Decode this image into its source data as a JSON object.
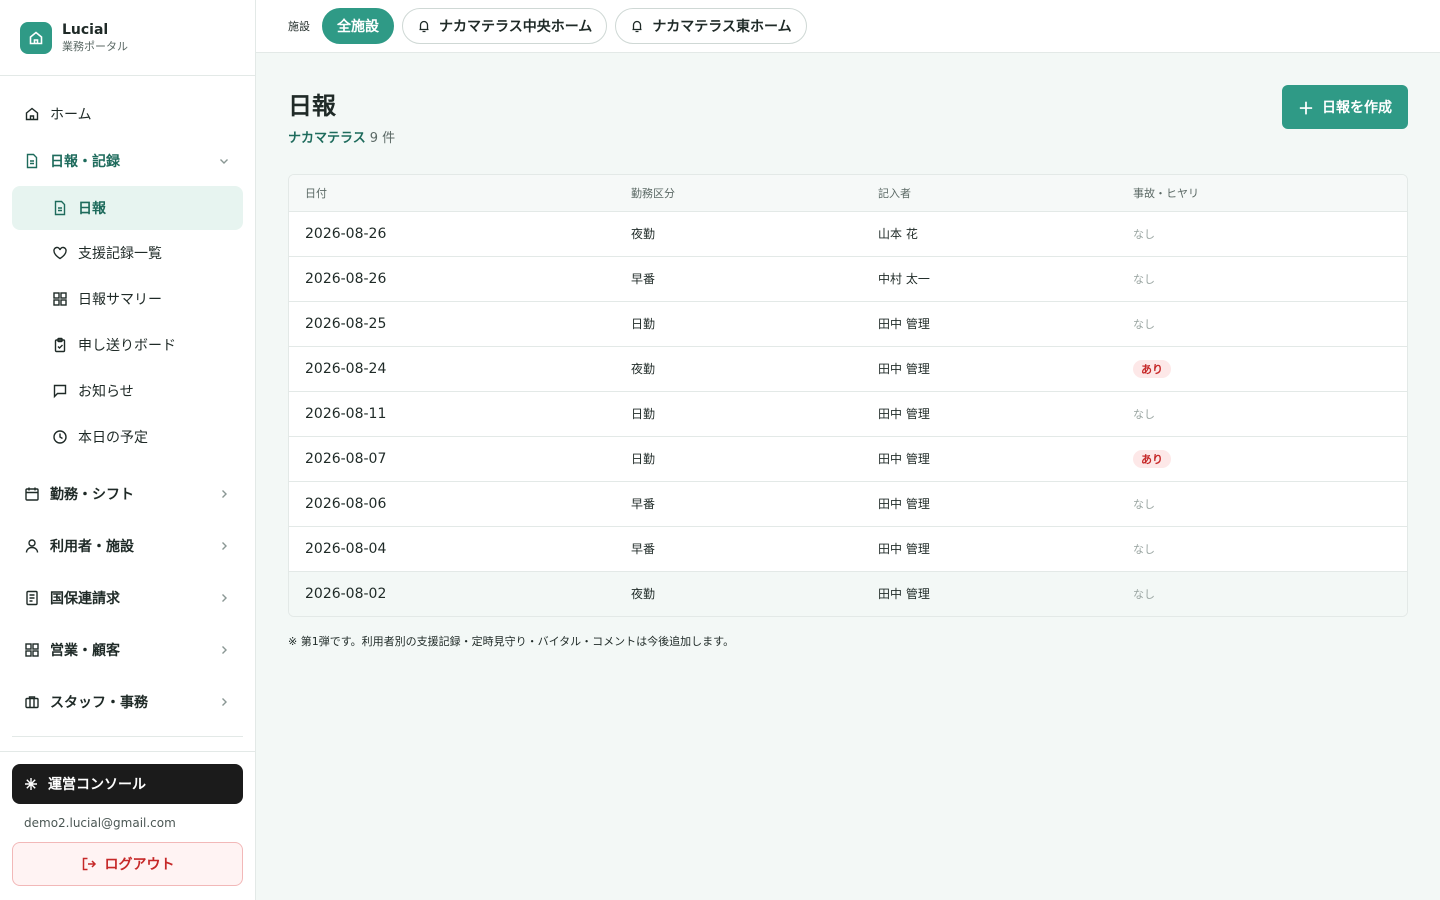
{
  "brand": {
    "name": "Lucial",
    "subtitle": "業務ポータル"
  },
  "sidebar": {
    "home": "ホーム",
    "groups": [
      {
        "label": "日報・記録",
        "icon": "document-icon",
        "expanded": true
      },
      {
        "label": "勤務・シフト",
        "icon": "calendar-icon"
      },
      {
        "label": "利用者・施設",
        "icon": "user-icon"
      },
      {
        "label": "国保連請求",
        "icon": "receipt-icon"
      },
      {
        "label": "営業・顧客",
        "icon": "grid-icon"
      },
      {
        "label": "スタッフ・事務",
        "icon": "briefcase-icon"
      }
    ],
    "sub_items": [
      {
        "label": "日報",
        "icon": "document-icon",
        "active": true
      },
      {
        "label": "支援記録一覧",
        "icon": "heart-icon"
      },
      {
        "label": "日報サマリー",
        "icon": "grid-icon"
      },
      {
        "label": "申し送りボード",
        "icon": "clipboard-icon"
      },
      {
        "label": "お知らせ",
        "icon": "message-icon"
      },
      {
        "label": "本日の予定",
        "icon": "clock-icon"
      }
    ],
    "console_label": "運営コンソール",
    "user_email": "demo2.lucial@gmail.com",
    "logout_label": "ログアウト"
  },
  "topbar": {
    "facility_label": "施設",
    "chips": [
      {
        "label": "全施設",
        "selected": true
      },
      {
        "label": "ナカマテラス中央ホーム",
        "selected": false
      },
      {
        "label": "ナカマテラス東ホーム",
        "selected": false
      }
    ]
  },
  "page": {
    "title": "日報",
    "facility": "ナカマテラス",
    "count": "9 件",
    "create_label": "日報を作成",
    "note": "※ 第1弾です。利用者別の支援記録・定時見守り・バイタル・コメントは今後追加します。"
  },
  "table": {
    "columns": [
      "日付",
      "勤務区分",
      "記入者",
      "事故・ヒヤリ"
    ],
    "rows": [
      {
        "date": "2026-08-26",
        "shift": "夜勤",
        "author": "山本 花",
        "incident": "なし"
      },
      {
        "date": "2026-08-26",
        "shift": "早番",
        "author": "中村 太一",
        "incident": "なし"
      },
      {
        "date": "2026-08-25",
        "shift": "日勤",
        "author": "田中 管理",
        "incident": "なし"
      },
      {
        "date": "2026-08-24",
        "shift": "夜勤",
        "author": "田中 管理",
        "incident": "あり"
      },
      {
        "date": "2026-08-11",
        "shift": "日勤",
        "author": "田中 管理",
        "incident": "なし"
      },
      {
        "date": "2026-08-07",
        "shift": "日勤",
        "author": "田中 管理",
        "incident": "あり"
      },
      {
        "date": "2026-08-06",
        "shift": "早番",
        "author": "田中 管理",
        "incident": "なし"
      },
      {
        "date": "2026-08-04",
        "shift": "早番",
        "author": "田中 管理",
        "incident": "なし"
      },
      {
        "date": "2026-08-02",
        "shift": "夜勤",
        "author": "田中 管理",
        "incident": "なし"
      }
    ]
  },
  "colors": {
    "accent": "#2f9a86",
    "danger": "#c62828",
    "active_bg": "#e7f4f0"
  }
}
